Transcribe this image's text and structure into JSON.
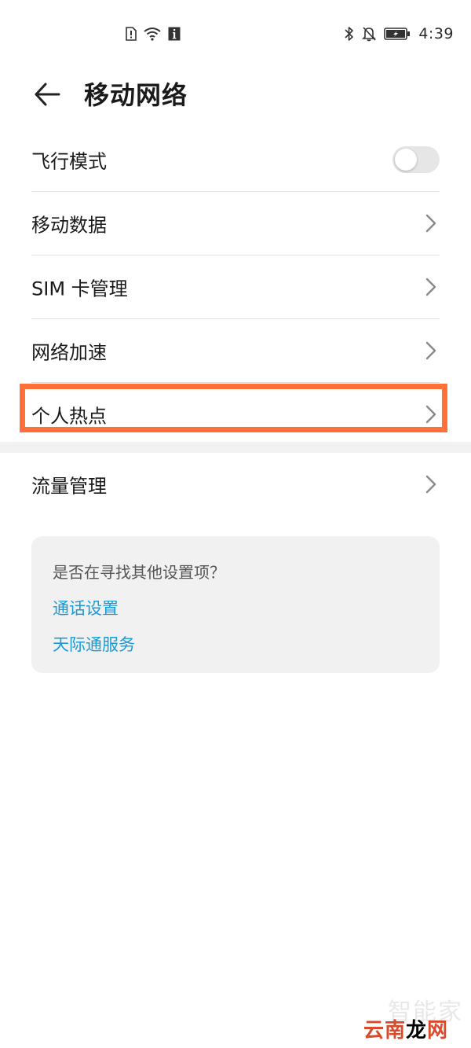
{
  "status_bar": {
    "time": "4:39",
    "icons": [
      "sim-alert-icon",
      "wifi-icon",
      "info-icon",
      "bluetooth-icon",
      "bell-off-icon",
      "battery-charging-icon"
    ]
  },
  "header": {
    "title": "移动网络",
    "back_icon": "arrow-left-icon"
  },
  "settings": [
    {
      "label": "飞行模式",
      "control": "toggle",
      "enabled": false
    },
    {
      "label": "移动数据",
      "control": "chevron"
    },
    {
      "label": "SIM 卡管理",
      "control": "chevron"
    },
    {
      "label": "网络加速",
      "control": "chevron"
    },
    {
      "label": "个人热点",
      "control": "chevron",
      "highlighted": true
    }
  ],
  "settings2": [
    {
      "label": "流量管理",
      "control": "chevron"
    }
  ],
  "suggestions": {
    "title": "是否在寻找其他设置项？",
    "links": [
      "通话设置",
      "天际通服务"
    ]
  },
  "watermark": {
    "faint": "智能家",
    "main_red": "云南",
    "main_black": "龙",
    "main_red2": "网"
  },
  "colors": {
    "accent_link": "#1a9bd7",
    "highlight": "#ff7138",
    "toggle_off": "#e6e6e6"
  }
}
